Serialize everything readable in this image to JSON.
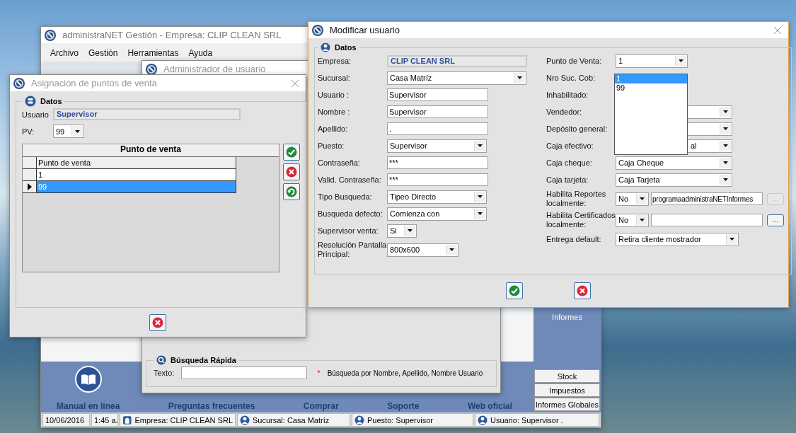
{
  "main_window": {
    "title": "administraNET Gestión - Empresa: CLIP CLEAN SRL",
    "menu": [
      "Archivo",
      "Gestión",
      "Herramientas",
      "Ayuda"
    ],
    "links": [
      {
        "label": "Manual en línea",
        "kind": "book"
      },
      {
        "label": "Preguntas frecuentes",
        "kind": "plain"
      },
      {
        "label": "Comprar",
        "kind": "plain"
      },
      {
        "label": "Soporte",
        "kind": "plain"
      },
      {
        "label": "Web oficial",
        "kind": "plain"
      }
    ],
    "informes": {
      "label": "Informes",
      "buttons": [
        "Stock",
        "Impuestos",
        "Informes Globales"
      ]
    },
    "status_bar": [
      {
        "text": "10/06/2016",
        "kind": "plain"
      },
      {
        "text": "1:45 a.",
        "kind": "plain"
      },
      {
        "text": "Empresa: CLIP CLEAN SRL",
        "kind": "building"
      },
      {
        "text": "Sucursal: Casa Matríz",
        "kind": "person"
      },
      {
        "text": "Puesto: Supervisor",
        "kind": "person"
      },
      {
        "text": "Usuario: Supervisor .",
        "kind": "person"
      }
    ]
  },
  "user_admin_window": {
    "title": "Administrador de usuario",
    "search": {
      "title": "Búsqueda Rápida",
      "label": "Texto:",
      "mark": "*",
      "note": "Búsqueda por Nombre, Apellido, Nombre Usuario"
    }
  },
  "assign_window": {
    "title": "Asignacion de puntos de venta",
    "group": "Datos",
    "user_label": "Usuario",
    "user": "Supervisor",
    "pv_label": "PV:",
    "pv": "99",
    "grid": {
      "title": "Punto de venta",
      "column": "Punto de venta",
      "rows": [
        {
          "value": "1",
          "selected": false
        },
        {
          "value": "99",
          "selected": true
        }
      ]
    }
  },
  "modify_window": {
    "title": "Modificar usuario",
    "group": "Datos",
    "left": [
      {
        "label": "Empresa:",
        "kind": "readonly",
        "value": "CLIP CLEAN SRL"
      },
      {
        "label": "Sucursal:",
        "kind": "combo",
        "value": "Casa Matríz"
      },
      {
        "label": "Usuario :",
        "kind": "text",
        "value": "Supervisor"
      },
      {
        "label": "Nombre :",
        "kind": "text",
        "value": "Supervisor"
      },
      {
        "label": "Apellido:",
        "kind": "text",
        "value": "."
      },
      {
        "label": "Puesto:",
        "kind": "combo",
        "value": "Supervisor"
      },
      {
        "label": "Contraseña:",
        "kind": "text",
        "value": "***"
      },
      {
        "label": "Valid. Contraseña:",
        "kind": "text",
        "value": "***"
      },
      {
        "label": "Tipo Busqueda:",
        "kind": "combo",
        "value": "Tipeo Directo"
      },
      {
        "label": "Busqueda defecto:",
        "kind": "combo",
        "value": "Comienza con"
      },
      {
        "label": "Supervisor venta:",
        "kind": "combo",
        "value": "Si"
      },
      {
        "label": "Resolución Pantalla Principal:",
        "kind": "combo",
        "value": "800x600"
      }
    ],
    "right": [
      {
        "label": "Punto de Venta:",
        "kind": "combo",
        "value": "1"
      },
      {
        "label": "Nro Suc. Cob:",
        "kind": "hidden"
      },
      {
        "label": "Inhabilitado:",
        "kind": "hidden"
      },
      {
        "label": "Vendedor:",
        "kind": "combo"
      },
      {
        "label": "Depósito general:",
        "kind": "combo"
      },
      {
        "label": "Caja efectivo:",
        "kind": "covered_combo",
        "value": "al"
      },
      {
        "label": "Caja cheque:",
        "kind": "combo",
        "value": "Caja Cheque"
      },
      {
        "label": "Caja tarjeta:",
        "kind": "combo",
        "value": "Caja Tarjeta"
      },
      {
        "label": "Habilita Reportes localmente:",
        "kind": "path",
        "value": "No",
        "path": "programaadministraNETInformes",
        "browse": {
          "label": "...",
          "disabled": true
        }
      },
      {
        "label": "Habilita Certificados localmente:",
        "kind": "path",
        "value": "No",
        "browse": {
          "label": "...",
          "disabled": false
        }
      },
      {
        "label": "Entrega default:",
        "kind": "combo",
        "value": "Retira cliente mostrador"
      }
    ],
    "dropdown": [
      {
        "label": "1",
        "selected": true
      },
      {
        "label": "99",
        "selected": false
      }
    ]
  }
}
